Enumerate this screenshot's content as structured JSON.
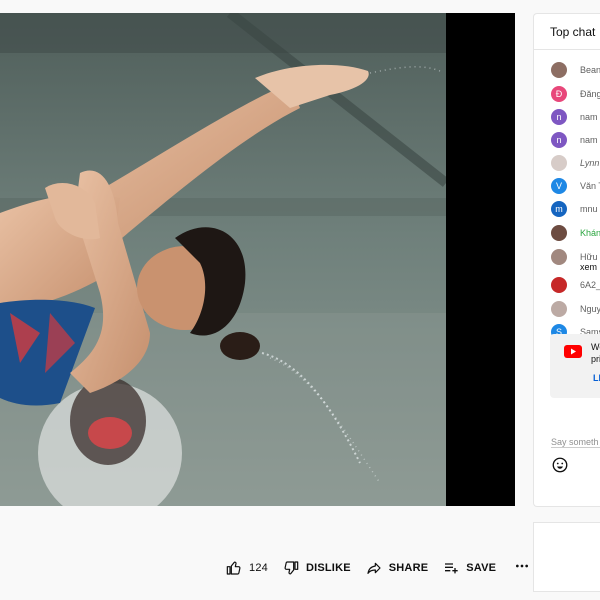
{
  "video": {
    "description_alt": ""
  },
  "actions": {
    "like_count": "124",
    "dislike_label": "DISLIKE",
    "share_label": "SHARE",
    "save_label": "SAVE"
  },
  "chat": {
    "header": "Top chat",
    "messages": [
      {
        "name": "Bean",
        "avatar_text": "",
        "avatar_color": "#8d6e63",
        "style": "normal"
      },
      {
        "name": "Đăng",
        "avatar_text": "Đ",
        "avatar_color": "#e8477a",
        "style": "normal"
      },
      {
        "name": "nam",
        "avatar_text": "n",
        "avatar_color": "#7e57c2",
        "style": "normal"
      },
      {
        "name": "nam",
        "avatar_text": "n",
        "avatar_color": "#7e57c2",
        "style": "normal"
      },
      {
        "name": "Lynn",
        "avatar_text": "",
        "avatar_color": "#d7ccc8",
        "style": "italic"
      },
      {
        "name": "Văn T",
        "avatar_text": "V",
        "avatar_color": "#1e88e5",
        "style": "normal"
      },
      {
        "name": "mnu",
        "avatar_text": "m",
        "avatar_color": "#1565c0",
        "style": "normal"
      },
      {
        "name": "Khán",
        "avatar_text": "",
        "avatar_color": "#6d4c41",
        "style": "green"
      },
      {
        "name": "Hữu",
        "avatar_text": "",
        "avatar_color": "#a1887f",
        "style": "normal",
        "sub": "xem"
      },
      {
        "name": "6A2_",
        "avatar_text": "",
        "avatar_color": "#c62828",
        "style": "normal"
      },
      {
        "name": "Nguy",
        "avatar_text": "",
        "avatar_color": "#bcaaa4",
        "style": "normal"
      },
      {
        "name": "Sams",
        "avatar_text": "S",
        "avatar_color": "#1e88e5",
        "style": "normal"
      }
    ],
    "promo": {
      "line1": "We",
      "line2": "pri",
      "link": "LE"
    },
    "input_placeholder": "Say someth"
  }
}
